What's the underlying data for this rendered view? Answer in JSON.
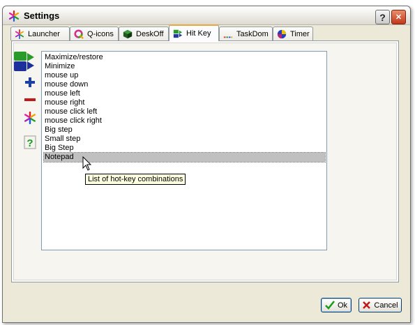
{
  "window": {
    "title": "Settings"
  },
  "titlebar": {
    "help_label": "?",
    "close_label": "✕"
  },
  "tabs": [
    {
      "label": "Launcher",
      "icon": "asterisk-star-icon"
    },
    {
      "label": "Q-icons",
      "icon": "q-icons-icon"
    },
    {
      "label": "DeskOff",
      "icon": "cube-icon"
    },
    {
      "label": "Hit Key",
      "icon": "hotkey-icon",
      "active": true
    },
    {
      "label": "TaskDom",
      "icon": "taskbar-icon"
    },
    {
      "label": "Timer",
      "icon": "globe-clock-icon"
    }
  ],
  "list": {
    "items": [
      "Maximize/restore",
      "Minimize",
      "mouse up",
      "mouse down",
      "mouse left",
      "mouse right",
      "mouse click left",
      "mouse click right",
      "Big step",
      "Small step",
      "Big Step",
      "Notepad"
    ],
    "selected": "Notepad"
  },
  "tooltip": {
    "text": "List of hot-key combinations"
  },
  "buttons": {
    "ok": "Ok",
    "cancel": "Cancel"
  },
  "colors": {
    "selection": "#c0c0c0",
    "tooltip_bg": "#ffffe1",
    "active_tab_accent": "#e6a93a",
    "close_red": "#c2381a"
  }
}
